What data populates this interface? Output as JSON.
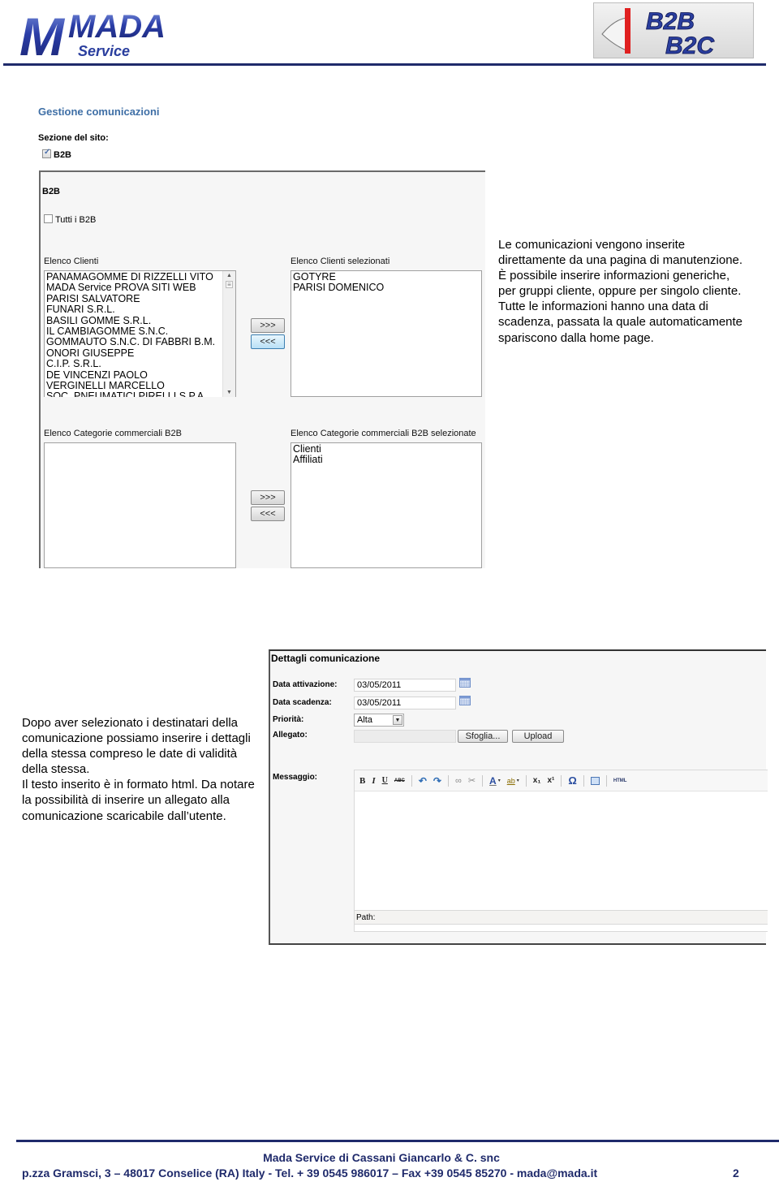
{
  "header": {
    "logo_left": {
      "main": "MADA",
      "sub": "Service"
    },
    "logo_right": {
      "line1": "B2B",
      "line2": "B2C"
    },
    "colors": {
      "brand_navy": "#1f2a6b",
      "logo_blue": "#2a3e9e",
      "logo_red": "#e02020"
    }
  },
  "screenshot1": {
    "title": "Gestione comunicazioni",
    "sezione_label": "Sezione del sito:",
    "b2b_checkbox": {
      "label": "B2B",
      "checked": true
    },
    "panel_label": "B2B",
    "tutti_checkbox": {
      "label": "Tutti i B2B",
      "checked": false
    },
    "clienti": {
      "available_label": "Elenco Clienti",
      "available": [
        "PANAMAGOMME DI RIZZELLI VITO",
        "MADA Service PROVA SITI WEB",
        "PARISI SALVATORE",
        "FUNARI S.R.L.",
        "BASILI GOMME S.R.L.",
        "IL CAMBIAGOMME S.N.C.",
        "GOMMAUTO S.N.C. DI FABBRI B.M.",
        "ONORI GIUSEPPE",
        "C.I.P. S.R.L.",
        "DE VINCENZI PAOLO",
        "VERGINELLI MARCELLO",
        "SOC. PNEUMATICI PIRELLI S.P.A."
      ],
      "selected_label": "Elenco Clienti selezionati",
      "selected": [
        "GOTYRE",
        "PARISI DOMENICO"
      ],
      "add_button": ">>>",
      "remove_button": "<<<"
    },
    "categorie": {
      "available_label": "Elenco Categorie commerciali B2B",
      "available": [],
      "selected_label": "Elenco Categorie commerciali B2B selezionate",
      "selected": [
        "Clienti",
        "Affiliati"
      ],
      "add_button": ">>>",
      "remove_button": "<<<"
    }
  },
  "paragraph_right": "Le comunicazioni vengono inserite direttamente da una pagina di manutenzione. È possibile inserire informazioni generiche, per gruppi cliente, oppure per singolo cliente. Tutte le informazioni hanno una data di scadenza, passata la quale automaticamente spariscono dalla home page.",
  "paragraph_left": "Dopo aver selezionato i destinatari della comunicazione possiamo inserire i dettagli della stessa compreso le date di validità della stessa.\nIl testo inserito è in formato html. Da notare la possibilità di inserire un allegato alla comunicazione scaricabile dall’utente.",
  "screenshot2": {
    "title": "Dettagli comunicazione",
    "data_attivazione": {
      "label": "Data attivazione:",
      "value": "03/05/2011"
    },
    "data_scadenza": {
      "label": "Data scadenza:",
      "value": "03/05/2011"
    },
    "priorita": {
      "label": "Priorità:",
      "value": "Alta"
    },
    "allegato": {
      "label": "Allegato:",
      "value": "",
      "browse_button": "Sfoglia...",
      "upload_button": "Upload"
    },
    "messaggio": {
      "label": "Messaggio:",
      "toolbar": [
        "bold",
        "italic",
        "underline",
        "strikethrough",
        "undo",
        "redo",
        "link",
        "unlink",
        "font-color",
        "highlight-color",
        "subscript",
        "superscript",
        "special-char",
        "table",
        "html"
      ],
      "toolbar_glyphs": {
        "bold": "B",
        "italic": "I",
        "underline": "U",
        "strikethrough": "ABC",
        "undo": "↶",
        "redo": "↷",
        "link": "∞",
        "unlink": "✂",
        "font_color": "A",
        "highlight": "ab",
        "dropdown": "▾",
        "subscript": "x₁",
        "superscript": "x¹",
        "special_char": "Ω",
        "html": "HTML"
      },
      "path_label": "Path:"
    }
  },
  "footer": {
    "company": "Mada Service di Cassani Giancarlo & C. snc",
    "address": "p.zza Gramsci, 3 – 48017 Conselice (RA) Italy - Tel. + 39 0545 986017 – Fax +39 0545 85270 - mada@mada.it",
    "page_number": "2"
  }
}
